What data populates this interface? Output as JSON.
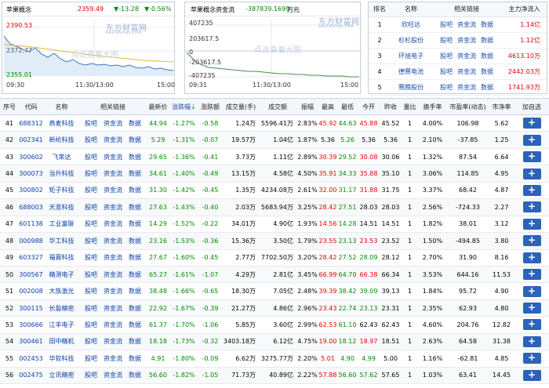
{
  "panel1": {
    "name": "苹果概念",
    "price": "2359.49",
    "change": "▼-13.28",
    "pct": "▼-0.56%",
    "ymax": "2390.53",
    "ymid": "2372.77",
    "ymin": "2355.01",
    "t0": "09:30",
    "t1": "11:30/13:00",
    "t2": "15:00",
    "watermark": "东方财富网",
    "watermark_sub": "eastmoney.com",
    "overlay": "点击查看大图"
  },
  "panel2": {
    "name": "苹果概念资金流",
    "value": "-387839.1699",
    "unit": "万元",
    "ymax": "407235",
    "ymid": "203617.5",
    "y0": "0",
    "yneg": "-203617.5",
    "ymin": "-407235",
    "t0": "09:31",
    "t1": "11:30/13:00",
    "t2": "15:00",
    "watermark": "东方财富网",
    "watermark_sub": "eastmoney.com",
    "overlay": "点击查看大图"
  },
  "ranking": {
    "headers": [
      "排名",
      "名称",
      "相关链接",
      "主力净流入"
    ],
    "links": [
      "股吧",
      "资金流",
      "数据"
    ],
    "rows": [
      {
        "rank": "1",
        "name": "欣旺达",
        "value": "1.14亿"
      },
      {
        "rank": "2",
        "name": "杉杉股份",
        "value": "1.12亿"
      },
      {
        "rank": "3",
        "name": "环旭电子",
        "value": "4613.10万"
      },
      {
        "rank": "4",
        "name": "德赛电池",
        "value": "2442.03万"
      },
      {
        "rank": "5",
        "name": "赛腾股份",
        "value": "1741.93万"
      }
    ]
  },
  "table": {
    "headers": [
      "序号",
      "代码",
      "名称",
      "相关链接",
      "最新价",
      "涨跌幅",
      "涨跌额",
      "成交量(手)",
      "成交额",
      "振幅",
      "最高",
      "最低",
      "今开",
      "昨收",
      "量比",
      "换手率",
      "市盈率(动态)",
      "市净率",
      "加自选"
    ],
    "links": [
      "股吧",
      "资金流",
      "数据"
    ],
    "add_label": "+",
    "rows": [
      {
        "no": "41",
        "code": "688312",
        "name": "燕麦科技",
        "price": "44.94",
        "pct": "-1.27%",
        "chg": "-0.58",
        "vol": "1.24万",
        "amt": "5596.41万",
        "amp": "2.83%",
        "high": "45.92",
        "low": "44.63",
        "open": "45.88",
        "prev": "45.52",
        "vr": "1",
        "turn": "4.00%",
        "pe": "106.98",
        "pb": "5.62",
        "hc": "red",
        "lc": "green",
        "oc": "red"
      },
      {
        "no": "42",
        "code": "002341",
        "name": "新纶科技",
        "price": "5.29",
        "pct": "-1.31%",
        "chg": "-0.07",
        "vol": "19.57万",
        "amt": "1.04亿",
        "amp": "1.87%",
        "high": "5.36",
        "low": "5.26",
        "open": "5.36",
        "prev": "5.36",
        "vr": "1",
        "turn": "2.10%",
        "pe": "-37.85",
        "pb": "1.25",
        "hc": "",
        "lc": "green",
        "oc": ""
      },
      {
        "no": "43",
        "code": "300602",
        "name": "飞荣达",
        "price": "29.65",
        "pct": "-1.36%",
        "chg": "-0.41",
        "vol": "3.73万",
        "amt": "1.11亿",
        "amp": "2.89%",
        "high": "30.39",
        "low": "29.52",
        "open": "30.08",
        "prev": "30.06",
        "vr": "1",
        "turn": "1.32%",
        "pe": "87.54",
        "pb": "6.64",
        "hc": "red",
        "lc": "green",
        "oc": "red"
      },
      {
        "no": "44",
        "code": "300073",
        "name": "当升科技",
        "price": "34.61",
        "pct": "-1.40%",
        "chg": "-0.49",
        "vol": "13.15万",
        "amt": "4.58亿",
        "amp": "4.50%",
        "high": "35.91",
        "low": "34.33",
        "open": "35.88",
        "prev": "35.10",
        "vr": "1",
        "turn": "3.06%",
        "pe": "114.85",
        "pb": "4.95",
        "hc": "red",
        "lc": "green",
        "oc": "red"
      },
      {
        "no": "45",
        "code": "300802",
        "name": "矩子科技",
        "price": "31.30",
        "pct": "-1.42%",
        "chg": "-0.45",
        "vol": "1.35万",
        "amt": "4234.08万",
        "amp": "2.61%",
        "high": "32.00",
        "low": "31.17",
        "open": "31.88",
        "prev": "31.75",
        "vr": "1",
        "turn": "3.37%",
        "pe": "68.42",
        "pb": "4.87",
        "hc": "red",
        "lc": "green",
        "oc": "red"
      },
      {
        "no": "46",
        "code": "688003",
        "name": "天准科技",
        "price": "27.63",
        "pct": "-1.43%",
        "chg": "-0.40",
        "vol": "2.03万",
        "amt": "5683.94万",
        "amp": "3.25%",
        "high": "28.42",
        "low": "27.51",
        "open": "28.03",
        "prev": "28.03",
        "vr": "1",
        "turn": "2.56%",
        "pe": "-724.33",
        "pb": "2.27",
        "hc": "red",
        "lc": "green",
        "oc": ""
      },
      {
        "no": "47",
        "code": "601138",
        "name": "工业富联",
        "price": "14.29",
        "pct": "-1.52%",
        "chg": "-0.22",
        "vol": "34.01万",
        "amt": "4.90亿",
        "amp": "1.93%",
        "high": "14.56",
        "low": "14.28",
        "open": "14.51",
        "prev": "14.51",
        "vr": "1",
        "turn": "1.82%",
        "pe": "38.01",
        "pb": "3.12",
        "hc": "red",
        "lc": "green",
        "oc": ""
      },
      {
        "no": "48",
        "code": "000988",
        "name": "华工科技",
        "price": "23.16",
        "pct": "-1.53%",
        "chg": "-0.36",
        "vol": "15.36万",
        "amt": "3.50亿",
        "amp": "1.79%",
        "high": "23.55",
        "low": "23.13",
        "open": "23.53",
        "prev": "23.52",
        "vr": "1",
        "turn": "1.50%",
        "pe": "-494.85",
        "pb": "3.80",
        "hc": "red",
        "lc": "green",
        "oc": "red"
      },
      {
        "no": "49",
        "code": "603327",
        "name": "福蓉科技",
        "price": "27.67",
        "pct": "-1.60%",
        "chg": "-0.45",
        "vol": "2.77万",
        "amt": "7702.50万",
        "amp": "3.20%",
        "high": "28.42",
        "low": "27.52",
        "open": "28.09",
        "prev": "28.12",
        "vr": "1",
        "turn": "2.70%",
        "pe": "31.90",
        "pb": "8.16",
        "hc": "red",
        "lc": "green",
        "oc": "green"
      },
      {
        "no": "50",
        "code": "300567",
        "name": "精测电子",
        "price": "65.27",
        "pct": "-1.61%",
        "chg": "-1.07",
        "vol": "4.29万",
        "amt": "2.81亿",
        "amp": "3.45%",
        "high": "66.99",
        "low": "64.70",
        "open": "66.38",
        "prev": "66.34",
        "vr": "1",
        "turn": "3.53%",
        "pe": "644.16",
        "pb": "11.53",
        "hc": "red",
        "lc": "green",
        "oc": "red"
      },
      {
        "no": "51",
        "code": "002008",
        "name": "大族激光",
        "price": "38.48",
        "pct": "-1.66%",
        "chg": "-0.65",
        "vol": "18.30万",
        "amt": "7.05亿",
        "amp": "2.48%",
        "high": "39.39",
        "low": "38.42",
        "open": "39.09",
        "prev": "39.13",
        "vr": "1",
        "turn": "1.84%",
        "pe": "95.72",
        "pb": "4.90",
        "hc": "red",
        "lc": "green",
        "oc": "green"
      },
      {
        "no": "52",
        "code": "300115",
        "name": "长盈精密",
        "price": "22.92",
        "pct": "-1.67%",
        "chg": "-0.39",
        "vol": "21.27万",
        "amt": "4.86亿",
        "amp": "2.96%",
        "high": "23.43",
        "low": "22.74",
        "open": "23.13",
        "prev": "23.31",
        "vr": "1",
        "turn": "2.35%",
        "pe": "62.93",
        "pb": "4.80",
        "hc": "red",
        "lc": "green",
        "oc": "green"
      },
      {
        "no": "53",
        "code": "300666",
        "name": "江丰电子",
        "price": "61.37",
        "pct": "-1.70%",
        "chg": "-1.06",
        "vol": "5.85万",
        "amt": "3.60亿",
        "amp": "2.99%",
        "high": "62.53",
        "low": "61.10",
        "open": "62.43",
        "prev": "62.43",
        "vr": "1",
        "turn": "4.60%",
        "pe": "204.76",
        "pb": "12.82",
        "hc": "red",
        "lc": "green",
        "oc": ""
      },
      {
        "no": "54",
        "code": "300461",
        "name": "田中精机",
        "price": "18.18",
        "pct": "-1.73%",
        "chg": "-0.32",
        "vol": "3403.18万",
        "amt": "6.12亿",
        "amp": "4.75%",
        "high": "19.00",
        "low": "18.12",
        "open": "18.97",
        "prev": "18.51",
        "vr": "1",
        "turn": "2.63%",
        "pe": "64.58",
        "pb": "31.38",
        "hc": "red",
        "lc": "green",
        "oc": "red"
      },
      {
        "no": "55",
        "code": "002453",
        "name": "华软科技",
        "price": "4.91",
        "pct": "-1.80%",
        "chg": "-0.09",
        "vol": "6.62万",
        "amt": "3275.77万",
        "amp": "2.20%",
        "high": "5.01",
        "low": "4.90",
        "open": "4.99",
        "prev": "5.00",
        "vr": "1",
        "turn": "1.16%",
        "pe": "-62.81",
        "pb": "4.85",
        "hc": "red",
        "lc": "green",
        "oc": "green"
      },
      {
        "no": "56",
        "code": "002475",
        "name": "立讯精密",
        "price": "56.60",
        "pct": "-1.82%",
        "chg": "-1.05",
        "vol": "71.73万",
        "amt": "40.89亿",
        "amp": "2.22%",
        "high": "57.88",
        "low": "56.60",
        "open": "57.62",
        "prev": "57.65",
        "vr": "1",
        "turn": "1.03%",
        "pe": "63.41",
        "pb": "14.45",
        "hc": "red",
        "lc": "green",
        "oc": "green"
      }
    ]
  },
  "colors": {
    "up": "#e10000",
    "down": "#008a00",
    "link": "#0a3fa5",
    "add_button": "#2b63b8"
  }
}
